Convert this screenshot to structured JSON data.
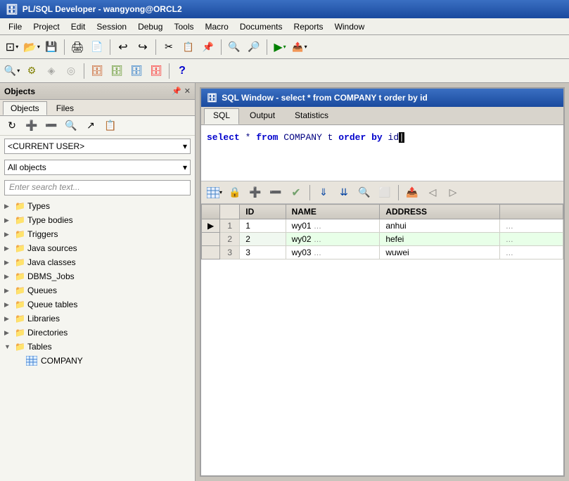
{
  "title_bar": {
    "icon": "🗄",
    "title": "PL/SQL Developer - wangyong@ORCL2"
  },
  "menu_bar": {
    "items": [
      "File",
      "Project",
      "Edit",
      "Session",
      "Debug",
      "Tools",
      "Macro",
      "Documents",
      "Reports",
      "Window"
    ]
  },
  "toolbar1": {
    "buttons": [
      {
        "name": "new-btn",
        "icon": "⊡",
        "label": "New"
      },
      {
        "name": "open-btn",
        "icon": "📂",
        "label": "Open"
      },
      {
        "name": "save-btn",
        "icon": "💾",
        "label": "Save"
      },
      {
        "name": "print-btn",
        "icon": "🖨",
        "label": "Print"
      },
      {
        "name": "print2-btn",
        "icon": "📄",
        "label": "Print2"
      },
      {
        "name": "undo-btn",
        "icon": "↩",
        "label": "Undo"
      },
      {
        "name": "redo-btn",
        "icon": "↪",
        "label": "Redo"
      },
      {
        "name": "cut-btn",
        "icon": "✂",
        "label": "Cut"
      },
      {
        "name": "copy-btn",
        "icon": "📋",
        "label": "Copy"
      },
      {
        "name": "paste-btn",
        "icon": "📌",
        "label": "Paste"
      },
      {
        "name": "find-btn",
        "icon": "🔍",
        "label": "Find"
      },
      {
        "name": "findnext-btn",
        "icon": "🔎",
        "label": "Find Next"
      },
      {
        "name": "run-btn",
        "icon": "▶",
        "label": "Run"
      },
      {
        "name": "export-btn",
        "icon": "📤",
        "label": "Export"
      }
    ]
  },
  "toolbar2": {
    "buttons": [
      {
        "name": "search-btn",
        "icon": "🔍",
        "label": "Search"
      },
      {
        "name": "config-btn",
        "icon": "⚙",
        "label": "Config"
      },
      {
        "name": "faded1",
        "icon": "◈",
        "label": "Faded1"
      },
      {
        "name": "db1-btn",
        "icon": "🗄",
        "label": "DB1"
      },
      {
        "name": "db2-btn",
        "icon": "🗄",
        "label": "DB2"
      },
      {
        "name": "db3-btn",
        "icon": "🗄",
        "label": "DB3"
      },
      {
        "name": "db4-btn",
        "icon": "🗄",
        "label": "DB4"
      },
      {
        "name": "help-btn",
        "icon": "?",
        "label": "Help"
      }
    ]
  },
  "left_panel": {
    "title": "Objects",
    "controls": [
      "📌",
      "✕"
    ],
    "tabs": [
      {
        "name": "objects-tab",
        "label": "Objects",
        "active": true
      },
      {
        "name": "files-tab",
        "label": "Files",
        "active": false
      }
    ],
    "obj_toolbar_icons": [
      "↻",
      "➕",
      "➖",
      "🔍",
      "↗",
      "📋"
    ],
    "current_user_dropdown": "<CURRENT USER>",
    "all_objects_dropdown": "All objects",
    "search_placeholder": "Enter search text...",
    "tree_items": [
      {
        "level": 0,
        "expand": "▶",
        "icon": "📁",
        "label": "Types",
        "has_children": true
      },
      {
        "level": 0,
        "expand": "▶",
        "icon": "📁",
        "label": "Type bodies",
        "has_children": true
      },
      {
        "level": 0,
        "expand": "▶",
        "icon": "📁",
        "label": "Triggers",
        "has_children": true
      },
      {
        "level": 0,
        "expand": "▶",
        "icon": "📁",
        "label": "Java sources",
        "has_children": true
      },
      {
        "level": 0,
        "expand": "▶",
        "icon": "📁",
        "label": "Java classes",
        "has_children": true
      },
      {
        "level": 0,
        "expand": "▶",
        "icon": "📁",
        "label": "DBMS_Jobs",
        "has_children": true
      },
      {
        "level": 0,
        "expand": "▶",
        "icon": "📁",
        "label": "Queues",
        "has_children": true
      },
      {
        "level": 0,
        "expand": "▶",
        "icon": "📁",
        "label": "Queue tables",
        "has_children": true
      },
      {
        "level": 0,
        "expand": "▶",
        "icon": "📁",
        "label": "Libraries",
        "has_children": true
      },
      {
        "level": 0,
        "expand": "▶",
        "icon": "📁",
        "label": "Directories",
        "has_children": true
      },
      {
        "level": 0,
        "expand": "▼",
        "icon": "📁",
        "label": "Tables",
        "has_children": true,
        "expanded": true
      },
      {
        "level": 1,
        "expand": " ",
        "icon": "⊞",
        "label": "COMPANY",
        "has_children": false
      }
    ]
  },
  "sql_window": {
    "icon": "🗄",
    "title": "SQL Window - select * from COMPANY t order by id",
    "tabs": [
      {
        "name": "sql-tab",
        "label": "SQL",
        "active": true
      },
      {
        "name": "output-tab",
        "label": "Output",
        "active": false
      },
      {
        "name": "statistics-tab",
        "label": "Statistics",
        "active": false
      }
    ],
    "sql_content": "select * from COMPANY t order by id",
    "cursor_pos": "end",
    "result_toolbar_icons": [
      "⊞▼",
      "🔒",
      "➕",
      "➖",
      "✔",
      "⬇⬇",
      "⬇⬇",
      "🔍",
      "⬜",
      "📤",
      "◁",
      "▷"
    ],
    "table": {
      "columns": [
        "",
        "ID",
        "NAME",
        "ADDRESS"
      ],
      "rows": [
        {
          "indicator": "▶",
          "row_num": "1",
          "id": "1",
          "name": "wy01",
          "address": "anhui"
        },
        {
          "indicator": "",
          "row_num": "2",
          "id": "2",
          "name": "wy02",
          "address": "hefei"
        },
        {
          "indicator": "",
          "row_num": "3",
          "id": "3",
          "name": "wy03",
          "address": "wuwei"
        }
      ]
    }
  },
  "colors": {
    "title_bg_start": "#3a6fc2",
    "title_bg_end": "#1a4a9e",
    "active_row_bg": "#d0f0d0",
    "toolbar_bg": "#f0f0ea",
    "panel_bg": "#f5f5f0"
  }
}
